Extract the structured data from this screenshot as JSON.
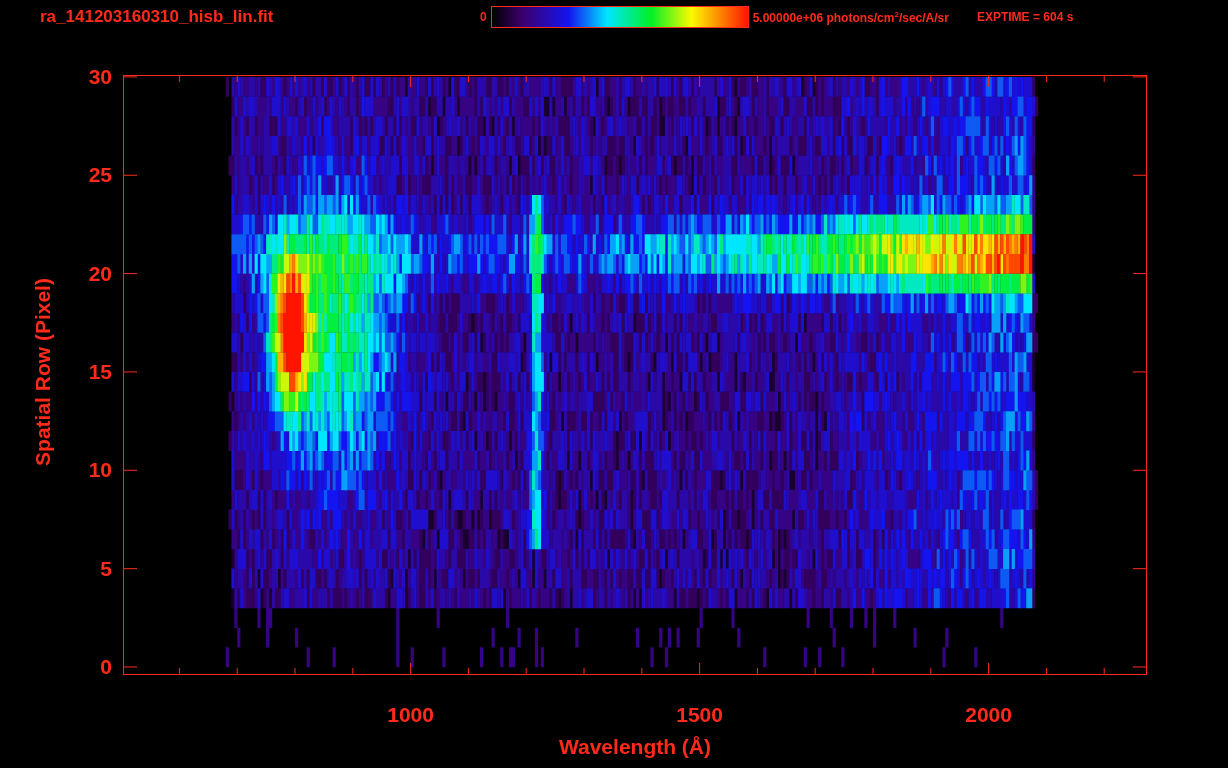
{
  "title": "ra_141203160310_hisb_lin.fit",
  "colorbar": {
    "min_label": "0",
    "max_label": "5.00000e+06 photons/cm$^{2}$/sec/A/sr"
  },
  "exposure": "EXPTIME = 604 s",
  "plot": {
    "xlabel": "Wavelength (Å)",
    "ylabel": "Spatial Row (Pixel)",
    "yticks": [
      "30",
      "25",
      "20",
      "15",
      "10",
      "5",
      "0"
    ],
    "xticks": [
      "1000",
      "1500",
      "2000"
    ]
  }
}
